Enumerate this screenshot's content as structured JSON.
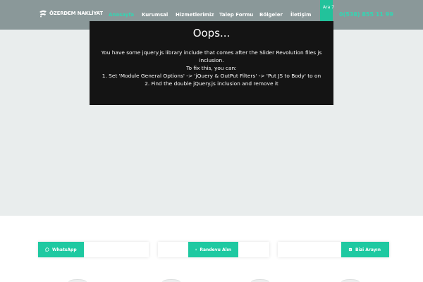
{
  "header": {
    "logo_text": "ÖZERDEM NAKLİYAT",
    "nav": [
      {
        "label": "Anasayfa",
        "active": true
      },
      {
        "label": "Kurumsal",
        "active": false
      },
      {
        "label": "Hizmetlerimiz",
        "active": false
      },
      {
        "label": "Talep Formu",
        "active": false
      },
      {
        "label": "Bölgeler",
        "active": false
      },
      {
        "label": "İletişim",
        "active": false
      }
    ],
    "call_label": "Ara 7",
    "call_icon": "whatsapp-icon",
    "phone_number": "0(538) 855 11 99"
  },
  "error": {
    "title": "Oops...",
    "line1": "You have some jquery.js library include that comes after the Slider Revolution files js inclusion.",
    "line2": "To fix this, you can:",
    "line3": "1. Set 'Module General Options' -> 'jQuery & OutPut Filters' -> 'Put JS to Body' to on",
    "line4": "2. Find the double jQuery.js inclusion and remove it"
  },
  "footer": {
    "whatsapp_label": "WhatsApp",
    "randevu_label": "Randevu Alın",
    "bizi_ara_label": "Bizi Arayın"
  },
  "colors": {
    "accent": "#1ec9a1",
    "header_bg": "#8a9899",
    "error_bg": "#141414"
  }
}
